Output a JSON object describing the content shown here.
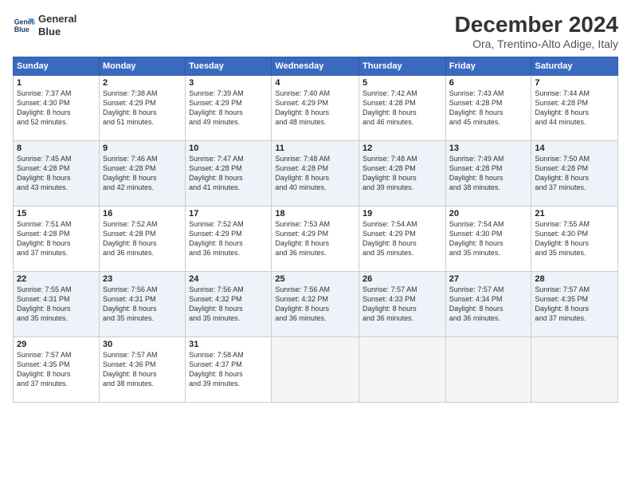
{
  "logo": {
    "line1": "General",
    "line2": "Blue"
  },
  "title": "December 2024",
  "subtitle": "Ora, Trentino-Alto Adige, Italy",
  "days_header": [
    "Sunday",
    "Monday",
    "Tuesday",
    "Wednesday",
    "Thursday",
    "Friday",
    "Saturday"
  ],
  "weeks": [
    [
      {
        "day": "1",
        "info": "Sunrise: 7:37 AM\nSunset: 4:30 PM\nDaylight: 8 hours\nand 52 minutes."
      },
      {
        "day": "2",
        "info": "Sunrise: 7:38 AM\nSunset: 4:29 PM\nDaylight: 8 hours\nand 51 minutes."
      },
      {
        "day": "3",
        "info": "Sunrise: 7:39 AM\nSunset: 4:29 PM\nDaylight: 8 hours\nand 49 minutes."
      },
      {
        "day": "4",
        "info": "Sunrise: 7:40 AM\nSunset: 4:29 PM\nDaylight: 8 hours\nand 48 minutes."
      },
      {
        "day": "5",
        "info": "Sunrise: 7:42 AM\nSunset: 4:28 PM\nDaylight: 8 hours\nand 46 minutes."
      },
      {
        "day": "6",
        "info": "Sunrise: 7:43 AM\nSunset: 4:28 PM\nDaylight: 8 hours\nand 45 minutes."
      },
      {
        "day": "7",
        "info": "Sunrise: 7:44 AM\nSunset: 4:28 PM\nDaylight: 8 hours\nand 44 minutes."
      }
    ],
    [
      {
        "day": "8",
        "info": "Sunrise: 7:45 AM\nSunset: 4:28 PM\nDaylight: 8 hours\nand 43 minutes."
      },
      {
        "day": "9",
        "info": "Sunrise: 7:46 AM\nSunset: 4:28 PM\nDaylight: 8 hours\nand 42 minutes."
      },
      {
        "day": "10",
        "info": "Sunrise: 7:47 AM\nSunset: 4:28 PM\nDaylight: 8 hours\nand 41 minutes."
      },
      {
        "day": "11",
        "info": "Sunrise: 7:48 AM\nSunset: 4:28 PM\nDaylight: 8 hours\nand 40 minutes."
      },
      {
        "day": "12",
        "info": "Sunrise: 7:48 AM\nSunset: 4:28 PM\nDaylight: 8 hours\nand 39 minutes."
      },
      {
        "day": "13",
        "info": "Sunrise: 7:49 AM\nSunset: 4:28 PM\nDaylight: 8 hours\nand 38 minutes."
      },
      {
        "day": "14",
        "info": "Sunrise: 7:50 AM\nSunset: 4:28 PM\nDaylight: 8 hours\nand 37 minutes."
      }
    ],
    [
      {
        "day": "15",
        "info": "Sunrise: 7:51 AM\nSunset: 4:28 PM\nDaylight: 8 hours\nand 37 minutes."
      },
      {
        "day": "16",
        "info": "Sunrise: 7:52 AM\nSunset: 4:28 PM\nDaylight: 8 hours\nand 36 minutes."
      },
      {
        "day": "17",
        "info": "Sunrise: 7:52 AM\nSunset: 4:29 PM\nDaylight: 8 hours\nand 36 minutes."
      },
      {
        "day": "18",
        "info": "Sunrise: 7:53 AM\nSunset: 4:29 PM\nDaylight: 8 hours\nand 36 minutes."
      },
      {
        "day": "19",
        "info": "Sunrise: 7:54 AM\nSunset: 4:29 PM\nDaylight: 8 hours\nand 35 minutes."
      },
      {
        "day": "20",
        "info": "Sunrise: 7:54 AM\nSunset: 4:30 PM\nDaylight: 8 hours\nand 35 minutes."
      },
      {
        "day": "21",
        "info": "Sunrise: 7:55 AM\nSunset: 4:30 PM\nDaylight: 8 hours\nand 35 minutes."
      }
    ],
    [
      {
        "day": "22",
        "info": "Sunrise: 7:55 AM\nSunset: 4:31 PM\nDaylight: 8 hours\nand 35 minutes."
      },
      {
        "day": "23",
        "info": "Sunrise: 7:56 AM\nSunset: 4:31 PM\nDaylight: 8 hours\nand 35 minutes."
      },
      {
        "day": "24",
        "info": "Sunrise: 7:56 AM\nSunset: 4:32 PM\nDaylight: 8 hours\nand 35 minutes."
      },
      {
        "day": "25",
        "info": "Sunrise: 7:56 AM\nSunset: 4:32 PM\nDaylight: 8 hours\nand 36 minutes."
      },
      {
        "day": "26",
        "info": "Sunrise: 7:57 AM\nSunset: 4:33 PM\nDaylight: 8 hours\nand 36 minutes."
      },
      {
        "day": "27",
        "info": "Sunrise: 7:57 AM\nSunset: 4:34 PM\nDaylight: 8 hours\nand 36 minutes."
      },
      {
        "day": "28",
        "info": "Sunrise: 7:57 AM\nSunset: 4:35 PM\nDaylight: 8 hours\nand 37 minutes."
      }
    ],
    [
      {
        "day": "29",
        "info": "Sunrise: 7:57 AM\nSunset: 4:35 PM\nDaylight: 8 hours\nand 37 minutes."
      },
      {
        "day": "30",
        "info": "Sunrise: 7:57 AM\nSunset: 4:36 PM\nDaylight: 8 hours\nand 38 minutes."
      },
      {
        "day": "31",
        "info": "Sunrise: 7:58 AM\nSunset: 4:37 PM\nDaylight: 8 hours\nand 39 minutes."
      },
      {
        "day": "",
        "info": ""
      },
      {
        "day": "",
        "info": ""
      },
      {
        "day": "",
        "info": ""
      },
      {
        "day": "",
        "info": ""
      }
    ]
  ]
}
